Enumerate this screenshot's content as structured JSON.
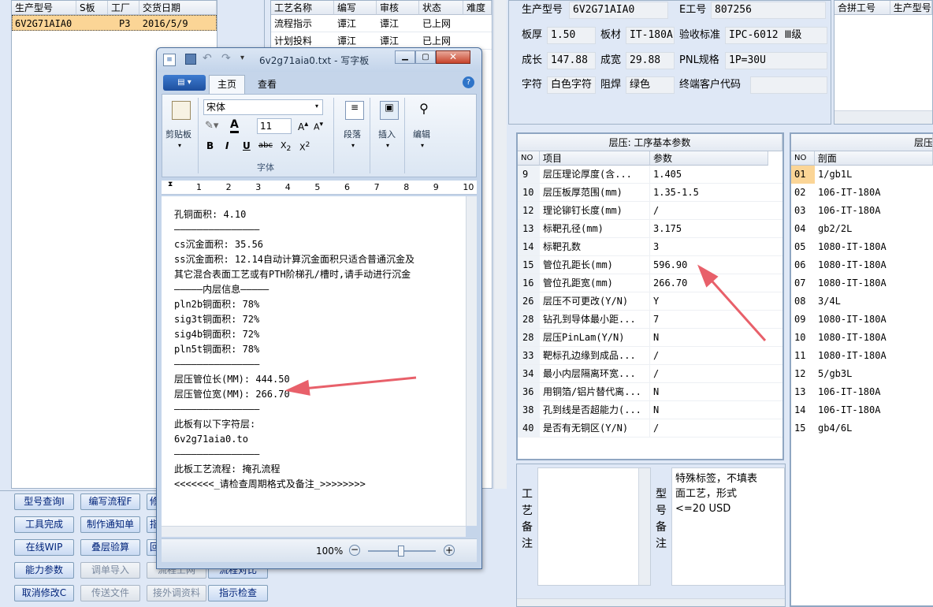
{
  "left_table": {
    "columns": [
      "生产型号",
      "S板",
      "工厂",
      "交货日期"
    ],
    "row": {
      "model": "6V2G71AIA0",
      "s": "",
      "factory": "P3",
      "date": "2016/5/9"
    }
  },
  "process_table": {
    "columns": [
      "工艺名称",
      "编写",
      "审核",
      "状态",
      "难度"
    ],
    "rows": [
      {
        "name": "流程指示",
        "author": "谭江",
        "reviewer": "谭江",
        "status": "已上网"
      },
      {
        "name": "计划投料",
        "author": "谭江",
        "reviewer": "谭江",
        "status": "已上网"
      }
    ]
  },
  "buttons": [
    {
      "label": "型号查询I",
      "dis": false
    },
    {
      "label": "编写流程F",
      "dis": false
    },
    {
      "label": "修",
      "dis": false
    },
    {
      "label": "工具完成",
      "dis": false
    },
    {
      "label": "制作通知单",
      "dis": false
    },
    {
      "label": "指",
      "dis": false
    },
    {
      "label": "在线WIP",
      "dis": false
    },
    {
      "label": "叠层验算",
      "dis": false
    },
    {
      "label": "回",
      "dis": false
    },
    {
      "label": "能力参数",
      "dis": false
    },
    {
      "label": "调单导入",
      "dis": true
    },
    {
      "label": "流程上网",
      "dis": true
    },
    {
      "label": "流程对比",
      "dis": false
    },
    {
      "label": "取消修改C",
      "dis": false
    },
    {
      "label": "传送文件",
      "dis": true
    },
    {
      "label": "接外调资料",
      "dis": true
    },
    {
      "label": "指示检查",
      "dis": false
    }
  ],
  "info": {
    "model_label": "生产型号",
    "model": "6V2G71AIA0",
    "e_label": "E工号",
    "e": "807256",
    "thick_label": "板厚",
    "thick": "1.50",
    "mat_label": "板材",
    "mat": "IT-180A",
    "std_label": "验收标准",
    "std": "IPC-6012 Ⅲ级",
    "len_label": "成长",
    "len": "147.88",
    "wid_label": "成宽",
    "wid": "29.88",
    "pnl_label": "PNL规格",
    "pnl": "1P=30U",
    "char_label": "字符",
    "char": "白色字符",
    "mask_label": "阻焊",
    "mask": "绿色",
    "cust_label": "终端客户代码",
    "cust": ""
  },
  "merge_table": {
    "columns": [
      "合拼工号",
      "生产型号"
    ]
  },
  "lam_params": {
    "title": "层压: 工序基本参数",
    "columns": [
      "NO",
      "项目",
      "参数"
    ],
    "rows": [
      {
        "no": "9",
        "item": "层压理论厚度(含...",
        "val": "1.405"
      },
      {
        "no": "10",
        "item": "层压板厚范围(mm)",
        "val": "1.35-1.5"
      },
      {
        "no": "12",
        "item": "理论铆钉长度(mm)",
        "val": "/"
      },
      {
        "no": "13",
        "item": "标靶孔径(mm)",
        "val": "3.175"
      },
      {
        "no": "14",
        "item": "标靶孔数",
        "val": "3"
      },
      {
        "no": "15",
        "item": "管位孔距长(mm)",
        "val": "596.90"
      },
      {
        "no": "16",
        "item": "管位孔距宽(mm)",
        "val": "266.70"
      },
      {
        "no": "26",
        "item": "层压不可更改(Y/N)",
        "val": "Y"
      },
      {
        "no": "28",
        "item": "钻孔到导体最小距...",
        "val": "7"
      },
      {
        "no": "28",
        "item": "层压PinLam(Y/N)",
        "val": "N"
      },
      {
        "no": "33",
        "item": "靶标孔边缘到成品...",
        "val": "/"
      },
      {
        "no": "34",
        "item": "最小内层隔离环宽...",
        "val": "/"
      },
      {
        "no": "36",
        "item": "用铜箔/铝片替代离...",
        "val": "N"
      },
      {
        "no": "38",
        "item": "孔到线是否超能力(...",
        "val": "N"
      },
      {
        "no": "40",
        "item": "是否有无铜区(Y/N)",
        "val": "/"
      }
    ]
  },
  "stack": {
    "title": "层压",
    "columns": [
      "NO",
      "剖面"
    ],
    "rows": [
      {
        "no": "01",
        "v": "1/gb1L"
      },
      {
        "no": "02",
        "v": "106-IT-180A"
      },
      {
        "no": "03",
        "v": "106-IT-180A"
      },
      {
        "no": "04",
        "v": "gb2/2L"
      },
      {
        "no": "05",
        "v": "1080-IT-180A"
      },
      {
        "no": "06",
        "v": "1080-IT-180A"
      },
      {
        "no": "07",
        "v": "1080-IT-180A"
      },
      {
        "no": "08",
        "v": "3/4L"
      },
      {
        "no": "09",
        "v": "1080-IT-180A"
      },
      {
        "no": "10",
        "v": "1080-IT-180A"
      },
      {
        "no": "11",
        "v": "1080-IT-180A"
      },
      {
        "no": "12",
        "v": "5/gb3L"
      },
      {
        "no": "13",
        "v": "106-IT-180A"
      },
      {
        "no": "14",
        "v": "106-IT-180A"
      },
      {
        "no": "15",
        "v": "gb4/6L"
      }
    ]
  },
  "remarks": {
    "craft_label": [
      "工",
      "艺",
      "备",
      "注"
    ],
    "model_label": [
      "型",
      "号",
      "备",
      "注"
    ],
    "model_text": [
      "特殊标签，不填表",
      "面工艺，形式",
      "<=20 USD"
    ]
  },
  "wordpad": {
    "title": "6v2g71aia0.txt - 写字板",
    "tab_home": "主页",
    "tab_view": "查看",
    "font": "宋体",
    "size": "11",
    "clipboard": "剪贴板",
    "font_group": "字体",
    "paragraph": "段落",
    "insert": "插入",
    "edit": "编辑",
    "ruler": [
      "1",
      "2",
      "3",
      "4",
      "5",
      "6",
      "7",
      "8",
      "9",
      "10"
    ],
    "lines": [
      "孔铜面积: 4.10",
      "———————————————",
      "cs沉金面积: 35.56",
      "ss沉金面积: 12.14自动计算沉金面积只适合普通沉金及",
      "其它混合表面工艺或有PTH阶梯孔/槽时,请手动进行沉金",
      "—————内层信息—————",
      "pln2b铜面积: 78%",
      "sig3t铜面积: 72%",
      "sig4b铜面积: 72%",
      "pln5t铜面积: 78%",
      "———————————————",
      "层压管位长(MM): 444.50",
      "层压管位宽(MM): 266.70",
      "———————————————",
      "此板有以下字符层:",
      "6v2g71aia0.to",
      "———————————————",
      "此板工艺流程: 掩孔流程",
      "<<<<<<<_请检查周期格式及备注_>>>>>>>>"
    ],
    "zoom": "100%"
  },
  "colors": {
    "arrow": "#e8606a",
    "selected": "#fbd596",
    "accent": "#1c5aa8"
  }
}
